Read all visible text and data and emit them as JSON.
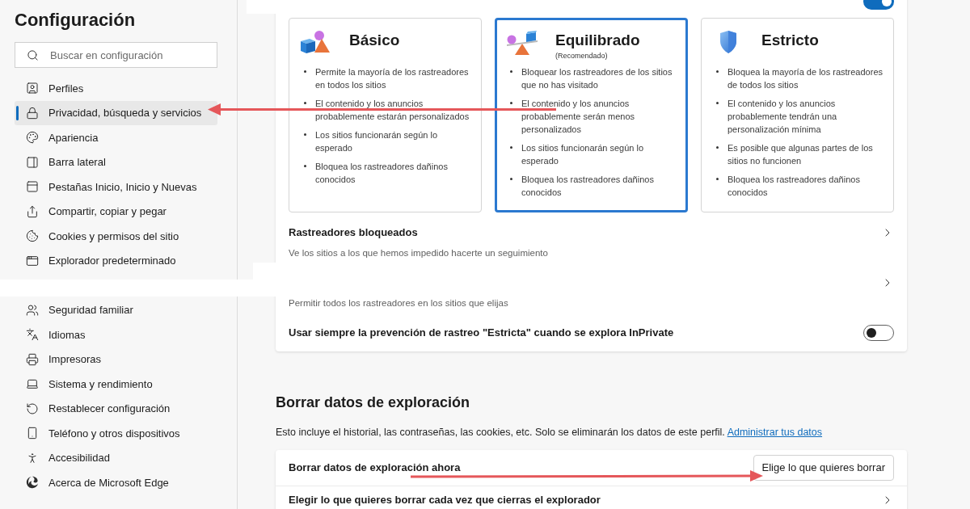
{
  "sidebar": {
    "title": "Configuración",
    "search": {
      "placeholder": "Buscar en configuración"
    },
    "groups": [
      [
        {
          "label": "Perfiles",
          "selected": false
        },
        {
          "label": "Privacidad, búsqueda y servicios",
          "selected": true
        },
        {
          "label": "Apariencia",
          "selected": false
        },
        {
          "label": "Barra lateral",
          "selected": false
        },
        {
          "label": "Pestañas Inicio, Inicio y Nuevas",
          "selected": false
        },
        {
          "label": "Compartir, copiar y pegar",
          "selected": false
        },
        {
          "label": "Cookies y permisos del sitio",
          "selected": false
        },
        {
          "label": "Explorador predeterminado",
          "selected": false
        }
      ],
      [
        {
          "label": "Seguridad familiar",
          "selected": false
        },
        {
          "label": "Idiomas",
          "selected": false
        },
        {
          "label": "Impresoras",
          "selected": false
        },
        {
          "label": "Sistema y rendimiento",
          "selected": false
        },
        {
          "label": "Restablecer configuración",
          "selected": false
        },
        {
          "label": "Teléfono y otros dispositivos",
          "selected": false
        },
        {
          "label": "Accesibilidad",
          "selected": false
        },
        {
          "label": "Acerca de Microsoft Edge",
          "selected": false
        }
      ]
    ]
  },
  "tracking_prevention": {
    "toggle": {
      "on": true
    },
    "levels": [
      {
        "title": "Básico",
        "selected": false,
        "bullets": [
          "Permite la mayoría de los rastreadores en todos los sitios",
          "El contenido y los anuncios probablemente estarán personalizados",
          "Los sitios funcionarán según lo esperado",
          "Bloquea los rastreadores dañinos conocidos"
        ]
      },
      {
        "title": "Equilibrado",
        "subtitle": "(Recomendado)",
        "selected": true,
        "bullets": [
          "Bloquear los rastreadores de los sitios que no has visitado",
          "El contenido y los anuncios probablemente serán menos personalizados",
          "Los sitios funcionarán según lo esperado",
          "Bloquea los rastreadores dañinos conocidos"
        ]
      },
      {
        "title": "Estricto",
        "selected": false,
        "bullets": [
          "Bloquea la mayoría de los rastreadores de todos los sitios",
          "El contenido y los anuncios probablemente tendrán una personalización mínima",
          "Es posible que algunas partes de los sitios no funcionen",
          "Bloquea los rastreadores dañinos conocidos"
        ]
      }
    ],
    "rows": [
      {
        "kind": "link",
        "title": "Rastreadores bloqueados",
        "description": "Ve los sitios a los que hemos impedido hacerte un seguimiento"
      },
      {
        "kind": "link",
        "description": "Permitir todos los rastreadores en los sitios que elijas"
      },
      {
        "kind": "toggle",
        "title": "Usar siempre la prevención de rastreo \"Estricta\" cuando se explora InPrivate",
        "on": false
      }
    ]
  },
  "clear_browsing_data": {
    "heading": "Borrar datos de exploración",
    "description": "Esto incluye el historial, las contraseñas, las cookies, etc. Solo se eliminarán los datos de este perfil.",
    "link": "Administrar tus datos",
    "rows": [
      {
        "kind": "button",
        "title": "Borrar datos de exploración ahora",
        "button": "Elige lo que quieres borrar"
      },
      {
        "kind": "link",
        "title": "Elegir lo que quieres borrar cada vez que cierras el explorador"
      }
    ]
  }
}
